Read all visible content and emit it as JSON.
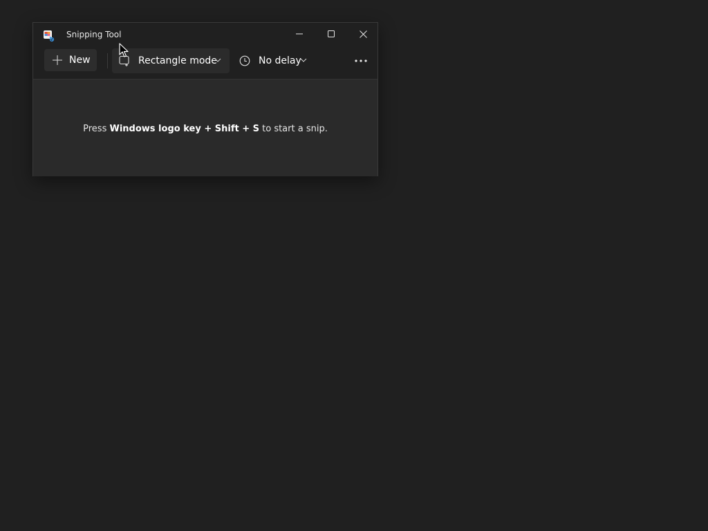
{
  "window": {
    "title": "Snipping Tool",
    "app_icon": "snipping-tool-icon",
    "controls": {
      "minimize_icon": "minimize-icon",
      "maximize_icon": "maximize-icon",
      "close_icon": "close-icon"
    }
  },
  "toolbar": {
    "new_label": "New",
    "new_icon": "plus-icon",
    "mode_label": "Rectangle mode",
    "mode_icon": "rectangle-snip-icon",
    "delay_label": "No delay",
    "delay_icon": "clock-icon",
    "more_icon": "more-options-icon"
  },
  "content": {
    "hint_prefix": "Press ",
    "hint_keys": "Windows logo key + Shift + S",
    "hint_suffix": " to start a snip."
  },
  "colors": {
    "desktop_bg": "#202020",
    "window_bg": "#202020",
    "content_bg": "#2a2a2a",
    "text": "#ffffff"
  }
}
